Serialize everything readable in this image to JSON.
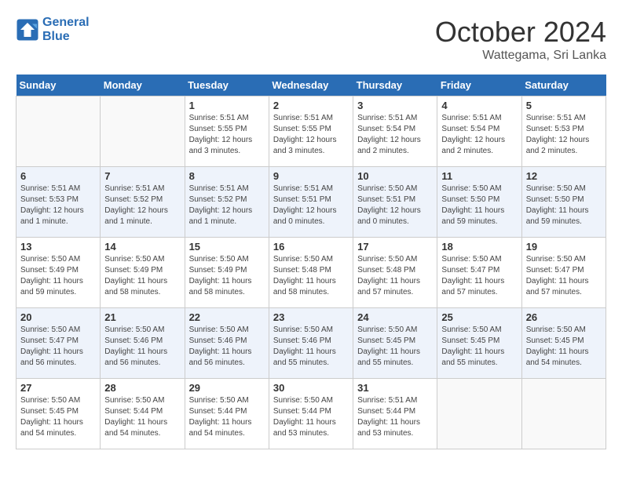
{
  "header": {
    "logo_line1": "General",
    "logo_line2": "Blue",
    "month": "October 2024",
    "location": "Wattegama, Sri Lanka"
  },
  "weekdays": [
    "Sunday",
    "Monday",
    "Tuesday",
    "Wednesday",
    "Thursday",
    "Friday",
    "Saturday"
  ],
  "weeks": [
    [
      {
        "day": "",
        "info": ""
      },
      {
        "day": "",
        "info": ""
      },
      {
        "day": "1",
        "info": "Sunrise: 5:51 AM\nSunset: 5:55 PM\nDaylight: 12 hours and 3 minutes."
      },
      {
        "day": "2",
        "info": "Sunrise: 5:51 AM\nSunset: 5:55 PM\nDaylight: 12 hours and 3 minutes."
      },
      {
        "day": "3",
        "info": "Sunrise: 5:51 AM\nSunset: 5:54 PM\nDaylight: 12 hours and 2 minutes."
      },
      {
        "day": "4",
        "info": "Sunrise: 5:51 AM\nSunset: 5:54 PM\nDaylight: 12 hours and 2 minutes."
      },
      {
        "day": "5",
        "info": "Sunrise: 5:51 AM\nSunset: 5:53 PM\nDaylight: 12 hours and 2 minutes."
      }
    ],
    [
      {
        "day": "6",
        "info": "Sunrise: 5:51 AM\nSunset: 5:53 PM\nDaylight: 12 hours and 1 minute."
      },
      {
        "day": "7",
        "info": "Sunrise: 5:51 AM\nSunset: 5:52 PM\nDaylight: 12 hours and 1 minute."
      },
      {
        "day": "8",
        "info": "Sunrise: 5:51 AM\nSunset: 5:52 PM\nDaylight: 12 hours and 1 minute."
      },
      {
        "day": "9",
        "info": "Sunrise: 5:51 AM\nSunset: 5:51 PM\nDaylight: 12 hours and 0 minutes."
      },
      {
        "day": "10",
        "info": "Sunrise: 5:50 AM\nSunset: 5:51 PM\nDaylight: 12 hours and 0 minutes."
      },
      {
        "day": "11",
        "info": "Sunrise: 5:50 AM\nSunset: 5:50 PM\nDaylight: 11 hours and 59 minutes."
      },
      {
        "day": "12",
        "info": "Sunrise: 5:50 AM\nSunset: 5:50 PM\nDaylight: 11 hours and 59 minutes."
      }
    ],
    [
      {
        "day": "13",
        "info": "Sunrise: 5:50 AM\nSunset: 5:49 PM\nDaylight: 11 hours and 59 minutes."
      },
      {
        "day": "14",
        "info": "Sunrise: 5:50 AM\nSunset: 5:49 PM\nDaylight: 11 hours and 58 minutes."
      },
      {
        "day": "15",
        "info": "Sunrise: 5:50 AM\nSunset: 5:49 PM\nDaylight: 11 hours and 58 minutes."
      },
      {
        "day": "16",
        "info": "Sunrise: 5:50 AM\nSunset: 5:48 PM\nDaylight: 11 hours and 58 minutes."
      },
      {
        "day": "17",
        "info": "Sunrise: 5:50 AM\nSunset: 5:48 PM\nDaylight: 11 hours and 57 minutes."
      },
      {
        "day": "18",
        "info": "Sunrise: 5:50 AM\nSunset: 5:47 PM\nDaylight: 11 hours and 57 minutes."
      },
      {
        "day": "19",
        "info": "Sunrise: 5:50 AM\nSunset: 5:47 PM\nDaylight: 11 hours and 57 minutes."
      }
    ],
    [
      {
        "day": "20",
        "info": "Sunrise: 5:50 AM\nSunset: 5:47 PM\nDaylight: 11 hours and 56 minutes."
      },
      {
        "day": "21",
        "info": "Sunrise: 5:50 AM\nSunset: 5:46 PM\nDaylight: 11 hours and 56 minutes."
      },
      {
        "day": "22",
        "info": "Sunrise: 5:50 AM\nSunset: 5:46 PM\nDaylight: 11 hours and 56 minutes."
      },
      {
        "day": "23",
        "info": "Sunrise: 5:50 AM\nSunset: 5:46 PM\nDaylight: 11 hours and 55 minutes."
      },
      {
        "day": "24",
        "info": "Sunrise: 5:50 AM\nSunset: 5:45 PM\nDaylight: 11 hours and 55 minutes."
      },
      {
        "day": "25",
        "info": "Sunrise: 5:50 AM\nSunset: 5:45 PM\nDaylight: 11 hours and 55 minutes."
      },
      {
        "day": "26",
        "info": "Sunrise: 5:50 AM\nSunset: 5:45 PM\nDaylight: 11 hours and 54 minutes."
      }
    ],
    [
      {
        "day": "27",
        "info": "Sunrise: 5:50 AM\nSunset: 5:45 PM\nDaylight: 11 hours and 54 minutes."
      },
      {
        "day": "28",
        "info": "Sunrise: 5:50 AM\nSunset: 5:44 PM\nDaylight: 11 hours and 54 minutes."
      },
      {
        "day": "29",
        "info": "Sunrise: 5:50 AM\nSunset: 5:44 PM\nDaylight: 11 hours and 54 minutes."
      },
      {
        "day": "30",
        "info": "Sunrise: 5:50 AM\nSunset: 5:44 PM\nDaylight: 11 hours and 53 minutes."
      },
      {
        "day": "31",
        "info": "Sunrise: 5:51 AM\nSunset: 5:44 PM\nDaylight: 11 hours and 53 minutes."
      },
      {
        "day": "",
        "info": ""
      },
      {
        "day": "",
        "info": ""
      }
    ]
  ]
}
